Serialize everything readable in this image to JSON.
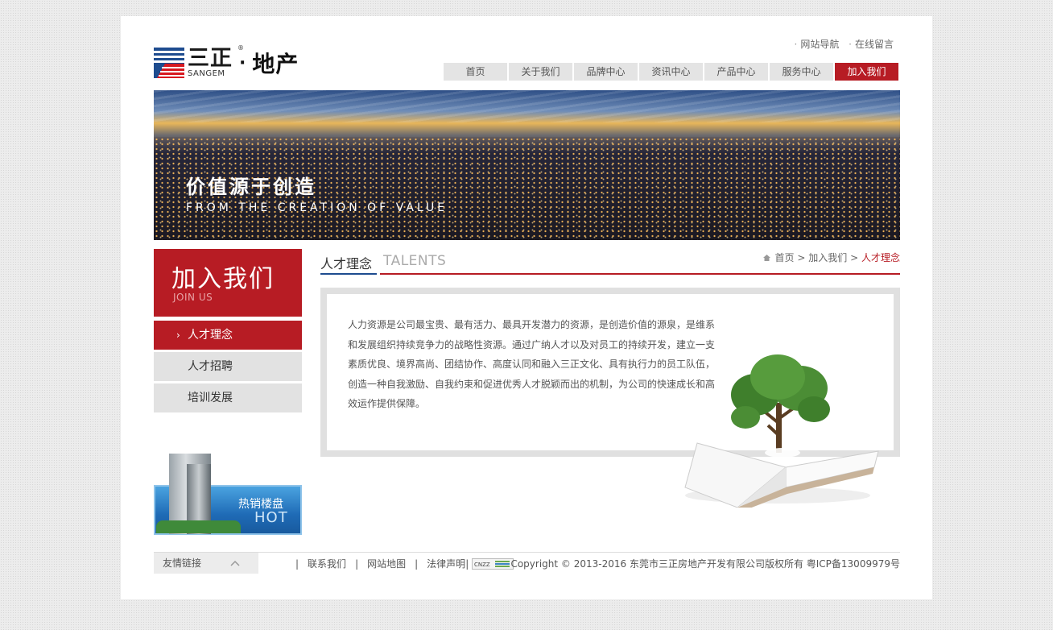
{
  "header": {
    "logo_cn": "三正",
    "logo_en": "SANGEM",
    "logo_dot": "·",
    "logo_sub": "地产",
    "logo_reg": "®",
    "top_links": [
      "网站导航",
      "在线留言"
    ]
  },
  "nav": {
    "items": [
      "首页",
      "关于我们",
      "品牌中心",
      "资讯中心",
      "产品中心",
      "服务中心",
      "加入我们"
    ],
    "active": "加入我们"
  },
  "banner": {
    "title": "价值源于创造",
    "subtitle": "FROM THE CREATION OF VALUE"
  },
  "sidebar": {
    "title_cn": "加入我们",
    "title_en": "JOIN US",
    "items": [
      {
        "label": "人才理念",
        "active": true
      },
      {
        "label": "人才招聘",
        "active": false
      },
      {
        "label": "培训发展",
        "active": false
      }
    ],
    "hot_cn": "热销楼盘",
    "hot_en": "HOT"
  },
  "content": {
    "title_cn": "人才理念",
    "title_en": "TALENTS",
    "breadcrumb": [
      "首页",
      "加入我们",
      "人才理念"
    ],
    "breadcrumb_sep": ">",
    "lines": [
      "人力资源是公司最宝贵、最有活力、最具开发潜力的资源，是创造价值的源泉，是维系",
      "和发展组织持续竞争力的战略性资源。通过广纳人才以及对员工的持续开发，建立一支",
      "素质优良、境界高尚、团结协作、高度认同和融入三正文化、具有执行力的员工队伍，",
      "创造一种自我激励、自我约束和促进优秀人才脱颖而出的机制，为公司的快速成长和高",
      "效运作提供保障。"
    ]
  },
  "footer": {
    "friend_links": "友情链接",
    "links": [
      "联系我们",
      "网站地图",
      "法律声明"
    ],
    "cnzz": "CNZZ",
    "copyright": "Copyright © 2013-2016 东莞市三正房地产开发有限公司版权所有 粤ICP备13009979号"
  },
  "colors": {
    "brand_red": "#b71c24",
    "brand_blue": "#1e4c8f",
    "nav_gray": "#e4e4e4"
  }
}
